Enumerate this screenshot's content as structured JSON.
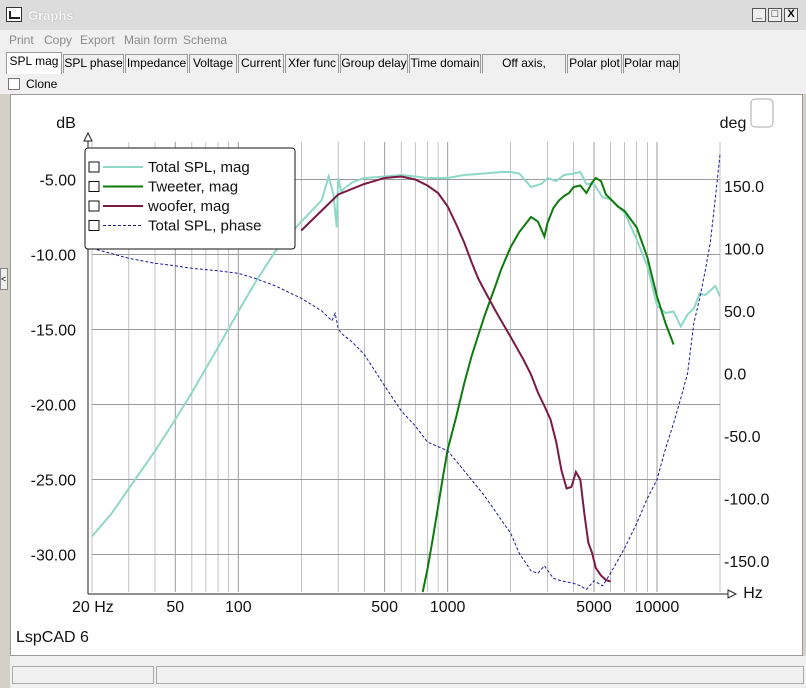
{
  "window": {
    "title": "Graphs",
    "minimize": "_",
    "maximize": "□",
    "close": "X"
  },
  "menu": [
    "Print",
    "Copy",
    "Export",
    "Main form",
    "Schema"
  ],
  "tabs": [
    "SPL mag",
    "SPL phase",
    "Impedance",
    "Voltage",
    "Current",
    "Xfer func",
    "Group delay",
    "Time domain",
    "Off axis, overlay",
    "Polar plot",
    "Polar map"
  ],
  "active_tab": "SPL mag",
  "options": {
    "clone_label": "Clone"
  },
  "footer_label": "LspCAD 6",
  "colors": {
    "total_spl": "#8fd8c6",
    "tweeter": "#0d7a0d",
    "woofer": "#7a1a44",
    "phase": "#1a1a9a",
    "grid": "#9a9a9a"
  },
  "chart_data": {
    "type": "line",
    "x_scale": "log",
    "xlabel": "Hz",
    "ylabel_left": "dB",
    "ylabel_right": "deg",
    "xlim": [
      20,
      20000
    ],
    "ylim_left": [
      -32.5,
      -2.5
    ],
    "ylim_right": [
      -175,
      185
    ],
    "x_ticks": [
      {
        "v": 20,
        "label": "20 Hz"
      },
      {
        "v": 50,
        "label": "50"
      },
      {
        "v": 100,
        "label": "100"
      },
      {
        "v": 500,
        "label": "500"
      },
      {
        "v": 1000,
        "label": "1000"
      },
      {
        "v": 5000,
        "label": "5000"
      },
      {
        "v": 10000,
        "label": "10000"
      }
    ],
    "y_ticks_left": [
      {
        "v": -5,
        "label": "-5.00"
      },
      {
        "v": -10,
        "label": "-10.00"
      },
      {
        "v": -15,
        "label": "-15.00"
      },
      {
        "v": -20,
        "label": "-20.00"
      },
      {
        "v": -25,
        "label": "-25.00"
      },
      {
        "v": -30,
        "label": "-30.00"
      }
    ],
    "y_ticks_right": [
      {
        "v": 150,
        "label": "150.0"
      },
      {
        "v": 100,
        "label": "100.0"
      },
      {
        "v": 50,
        "label": "50.0"
      },
      {
        "v": 0,
        "label": "0.0"
      },
      {
        "v": -50,
        "label": "-50.0"
      },
      {
        "v": -100,
        "label": "-100.0"
      },
      {
        "v": -150,
        "label": "-150.0"
      }
    ],
    "grid": true,
    "legend_position": "top-left",
    "series": [
      {
        "name": "Total SPL, mag",
        "axis": "left",
        "style": "solid",
        "color": "#8fd8c6",
        "x": [
          20,
          25,
          30,
          40,
          50,
          60,
          80,
          100,
          120,
          150,
          200,
          250,
          270,
          285,
          295,
          300,
          310,
          320,
          350,
          400,
          500,
          600,
          700,
          800,
          1000,
          1200,
          1500,
          1800,
          2000,
          2200,
          2500,
          2800,
          3000,
          3300,
          3600,
          4000,
          4300,
          4600,
          5000,
          5500,
          6000,
          7000,
          8000,
          9000,
          10000,
          11000,
          12000,
          13000,
          14000,
          15000,
          16000,
          17000,
          18000,
          19000,
          20000
        ],
        "y": [
          -28.8,
          -27.2,
          -25.6,
          -23.1,
          -21.0,
          -19.2,
          -16.2,
          -13.8,
          -11.9,
          -9.8,
          -7.8,
          -6.4,
          -4.8,
          -6.0,
          -8.2,
          -4.9,
          -5.8,
          -5.6,
          -5.2,
          -4.9,
          -4.8,
          -4.7,
          -4.8,
          -4.9,
          -4.9,
          -4.7,
          -4.6,
          -4.5,
          -4.5,
          -4.6,
          -5.5,
          -5.3,
          -4.9,
          -5.1,
          -4.7,
          -4.6,
          -4.5,
          -5.3,
          -5.3,
          -6.2,
          -6.3,
          -7.2,
          -9.0,
          -10.8,
          -13.4,
          -13.9,
          -13.8,
          -14.8,
          -14.0,
          -13.6,
          -12.6,
          -12.7,
          -12.4,
          -12.1,
          -12.8
        ]
      },
      {
        "name": "Tweeter, mag",
        "axis": "left",
        "style": "solid",
        "color": "#0d7a0d",
        "x": [
          760,
          800,
          850,
          900,
          950,
          1000,
          1100,
          1200,
          1300,
          1400,
          1500,
          1700,
          1800,
          2000,
          2200,
          2500,
          2700,
          2900,
          3000,
          3200,
          3400,
          3600,
          3800,
          4000,
          4300,
          4600,
          4900,
          5100,
          5400,
          5700,
          6000,
          6500,
          7000,
          8000,
          9000,
          10000,
          11000,
          12000
        ],
        "y": [
          -32.5,
          -31,
          -28.9,
          -26.8,
          -24.8,
          -23.0,
          -20.8,
          -18.6,
          -16.8,
          -15.4,
          -14.1,
          -12.0,
          -11.0,
          -9.5,
          -8.5,
          -7.5,
          -7.8,
          -8.8,
          -7.9,
          -6.9,
          -6.4,
          -6.1,
          -5.9,
          -5.5,
          -5.4,
          -5.9,
          -5.2,
          -4.9,
          -5.1,
          -6.0,
          -6.3,
          -6.8,
          -7.1,
          -8.2,
          -10.2,
          -12.8,
          -14.6,
          -16.0
        ]
      },
      {
        "name": "woofer, mag",
        "axis": "left",
        "style": "solid",
        "color": "#7a1a44",
        "x": [
          200,
          300,
          400,
          500,
          600,
          700,
          800,
          900,
          1000,
          1100,
          1200,
          1300,
          1400,
          1500,
          1700,
          2000,
          2300,
          2500,
          2700,
          2900,
          3100,
          3300,
          3500,
          3700,
          3900,
          4100,
          4300,
          4500,
          4700,
          4900,
          5100,
          5400,
          5700,
          6000
        ],
        "y": [
          -8.4,
          -6.0,
          -5.3,
          -4.9,
          -4.8,
          -5.0,
          -5.4,
          -5.9,
          -6.8,
          -8.0,
          -9.2,
          -10.5,
          -11.6,
          -12.4,
          -13.8,
          -15.5,
          -17.0,
          -18.0,
          -19.2,
          -20.1,
          -21.0,
          -22.5,
          -24.4,
          -25.6,
          -25.5,
          -24.5,
          -25.0,
          -27.3,
          -29.2,
          -29.9,
          -30.9,
          -31.4,
          -31.7,
          -31.8
        ]
      },
      {
        "name": "Total SPL, phase",
        "axis": "right",
        "style": "dashed",
        "color": "#1a1a9a",
        "x": [
          20,
          30,
          40,
          50,
          60,
          80,
          100,
          120,
          150,
          200,
          250,
          280,
          290,
          300,
          310,
          350,
          400,
          500,
          600,
          700,
          800,
          1000,
          1200,
          1500,
          2000,
          2200,
          2500,
          2700,
          2900,
          3200,
          3500,
          4000,
          4300,
          4600,
          5000,
          5500,
          6000,
          7000,
          8000,
          9000,
          10000,
          11000,
          12000,
          13000,
          14000,
          15000,
          16000,
          17000,
          18000,
          19000,
          20000
        ],
        "y": [
          100,
          92,
          88,
          86,
          84,
          82,
          80,
          76,
          70,
          60,
          50,
          42,
          48,
          36,
          32,
          25,
          15,
          -10,
          -30,
          -42,
          -55,
          -62,
          -78,
          -98,
          -128,
          -144,
          -158,
          -160,
          -154,
          -164,
          -166,
          -168,
          -170,
          -173,
          -166,
          -170,
          -160,
          -140,
          -120,
          -100,
          -85,
          -60,
          -40,
          -20,
          0,
          40,
          60,
          82,
          105,
          140,
          175
        ]
      }
    ]
  }
}
